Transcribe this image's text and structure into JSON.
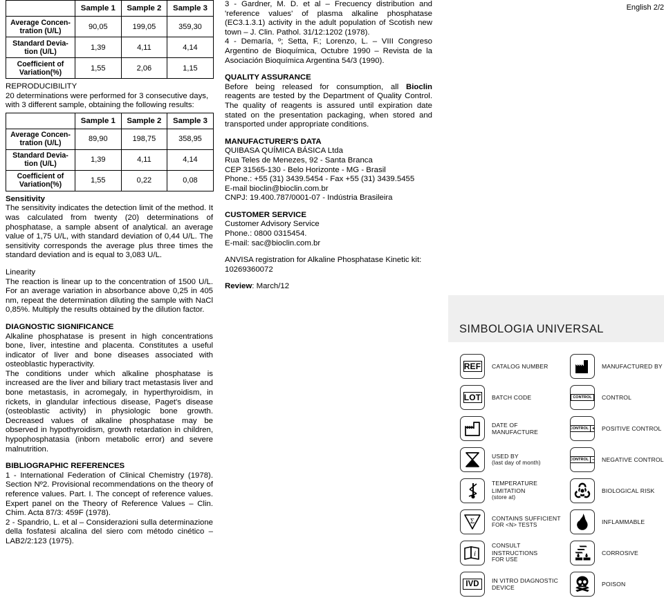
{
  "page": {
    "language_label": "English 2/2"
  },
  "left_column": {
    "table_precision": {
      "col_headers": [
        "",
        "Sample 1",
        "Sample 2",
        "Sample 3"
      ],
      "rows": [
        {
          "label": "Average Concen-\ntration (U/L)",
          "values": [
            "90,05",
            "199,05",
            "359,30"
          ]
        },
        {
          "label": "Standard Devia-\ntion (U/L)",
          "values": [
            "1,39",
            "4,11",
            "4,14"
          ]
        },
        {
          "label": "Coefficient of\nVariation(%)",
          "values": [
            "1,55",
            "2,06",
            "1,15"
          ]
        }
      ]
    },
    "reproducibility": {
      "heading": "REPRODUCIBILITY",
      "intro": "20 determinations were performed for 3 consecutive days, with 3 different sample, obtaining the following results:",
      "table": {
        "col_headers": [
          "",
          "Sample 1",
          "Sample 2",
          "Sample 3"
        ],
        "rows": [
          {
            "label": "Average Concen-\ntration (U/L)",
            "values": [
              "89,90",
              "198,75",
              "358,95"
            ]
          },
          {
            "label": "Standard Devia-\ntion (U/L)",
            "values": [
              "1,39",
              "4,11",
              "4,14"
            ]
          },
          {
            "label": "Coefficient of\nVariation(%)",
            "values": [
              "1,55",
              "0,22",
              "0,08"
            ]
          }
        ]
      }
    },
    "sensitivity": {
      "heading": "Sensitivity",
      "body": "The sensitivity indicates the detection limit of the method. It was calculated from twenty (20) determinations of phosphatase, a sample absent of analytical. an average value of 1,75 U/L, with standard deviation of 0,44 U/L. The sensitivity corresponds the average plus three times the standard deviation and is equal to 3,083 U/L."
    },
    "linearity": {
      "heading": "Linearity",
      "body": "The reaction is linear up to the concentration of 1500 U/L. For an average variation in absorbance above 0,25 in 405 nm, repeat the determination diluting the sample with NaCl 0,85%. Multiply the results obtained by the dilution factor."
    },
    "diagnostic_significance": {
      "heading": "DIAGNOSTIC SIGNIFICANCE",
      "paragraph_1": "Alkaline phosphatase is present in high concentrations bone, liver, intestine and placenta. Constitutes a useful indicator of liver and bone diseases associated with osteoblastic hyperactivity.",
      "paragraph_2": "The conditions under which alkaline phosphatase is increased are the liver and biliary tract metastasis liver and bone metastasis, in acromegaly, in hyperthyroidism, in rickets, in glandular infectious disease, Paget's disease (osteoblastic activity) in physiologic bone growth. Decreased values of alkaline phosphatase may be observed in hypothyroidism, growth retardation in children, hypophosphatasia (inborn metabolic error) and severe malnutrition."
    },
    "bibliographic_references": {
      "heading": "BIBLIOGRAPHIC REFERENCES",
      "ref_1": "1 - International Federation of Clinical Chemistry (1978). Section Nº2. Provisional recommendations on the theory of reference values. Part. I. The concept of reference values. Expert panel on the Theory of Reference Values – Clin. Chim. Acta 87/3: 459F (1978).",
      "ref_2": "2 - Spandrio, L. et al – Considerazioni sulla determinazione della fosfatesi alcalina del siero com método cinético – LAB2/2:123 (1975)."
    }
  },
  "middle_column": {
    "references_continued": {
      "ref_3": "3 - Gardner, M. D. et al – Frecuency distribution and 'reference values' of plasma alkaline phosphatase (EC3.1.3.1) activity in the adult population of Scotish new town – J. Clin. Pathol. 31/12:1202 (1978).",
      "ref_4": "4 - Demaría, º; Setta, F.; Lorenzo, L. – VIII Congreso Argentino de Bioquímica, Octubre 1990 – Revista de la Asociación Bioquímica Argentina 54/3 (1990)."
    },
    "quality_assurance": {
      "heading": "QUALITY ASSURANCE",
      "body_before_brand": "Before being released for consumption, all ",
      "brand": "Bioclin",
      "body_after_brand": " reagents are tested by the Department of Quality Control. The quality of reagents is assured until expiration date stated on the presentation packaging, when stored and transported under appropriate conditions."
    },
    "manufacturer_data": {
      "heading": "MANUFACTURER'S DATA",
      "lines": [
        "QUIBASA QUÍMICA BÁSICA Ltda",
        "Rua Teles de Menezes, 92 - Santa Branca",
        "CEP 31565-130 - Belo Horizonte - MG - Brasil",
        "Phone.: +55 (31) 3439.5454 - Fax +55 (31) 3439.5455",
        "E-mail bioclin@bioclin.com.br",
        "CNPJ: 19.400.787/0001-07 - Indústria Brasileira"
      ]
    },
    "customer_service": {
      "heading": "CUSTOMER SERVICE",
      "lines": [
        "Customer Advisory Service",
        "Phone.: 0800 0315454.",
        "E-mail: sac@bioclin.com.br"
      ]
    },
    "anvisa": {
      "line_1": "ANVISA registration for Alkaline Phosphatase Kinetic kit:",
      "line_2": "10269360072"
    },
    "review": {
      "label": "Review",
      "value": ": March/12"
    }
  },
  "right_column": {
    "symbols_band_title": "SIMBOLOGIA UNIVERSAL",
    "symbols_left": [
      {
        "icon": "ref-icon",
        "glyph": "REF",
        "label": "CATALOG NUMBER",
        "sublabel": ""
      },
      {
        "icon": "lot-icon",
        "glyph": "LOT",
        "label": "BATCH CODE",
        "sublabel": ""
      },
      {
        "icon": "factory-date-icon",
        "glyph": "",
        "label": "DATE OF MANUFACTURE",
        "sublabel": ""
      },
      {
        "icon": "hourglass-icon",
        "glyph": "",
        "label": "USED BY",
        "sublabel": "(last day of month)"
      },
      {
        "icon": "thermometer-icon",
        "glyph": "",
        "label": "TEMPERATURE LIMITATION",
        "sublabel": "(store at)"
      },
      {
        "icon": "sigma-triangle-icon",
        "glyph": "",
        "label": "CONTAINS SUFFICIENT",
        "sublabel": "FOR <N> TESTS"
      },
      {
        "icon": "instructions-book-icon",
        "glyph": "",
        "label": "CONSULT INSTRUCTIONS",
        "sublabel": "FOR USE"
      },
      {
        "icon": "ivd-icon",
        "glyph": "IVD",
        "label": "IN VITRO DIAGNOSTIC DEVICE",
        "sublabel": ""
      }
    ],
    "symbols_right": [
      {
        "icon": "factory-icon",
        "glyph": "",
        "sign": "",
        "label": "MANUFACTURED BY",
        "sublabel": ""
      },
      {
        "icon": "control-icon",
        "glyph": "CONTROL",
        "sign": "",
        "label": "CONTROL",
        "sublabel": ""
      },
      {
        "icon": "control-positive-icon",
        "glyph": "CONTROL",
        "sign": "+",
        "label": "POSITIVE CONTROL",
        "sublabel": ""
      },
      {
        "icon": "control-negative-icon",
        "glyph": "CONTROL",
        "sign": "–",
        "label": "NEGATIVE CONTROL",
        "sublabel": ""
      },
      {
        "icon": "biohazard-icon",
        "glyph": "",
        "sign": "",
        "label": "BIOLOGICAL RISK",
        "sublabel": ""
      },
      {
        "icon": "flame-icon",
        "glyph": "",
        "sign": "",
        "label": "INFLAMMABLE",
        "sublabel": ""
      },
      {
        "icon": "corrosive-icon",
        "glyph": "",
        "sign": "",
        "label": "CORROSIVE",
        "sublabel": ""
      },
      {
        "icon": "skull-icon",
        "glyph": "",
        "sign": "",
        "label": "POISON",
        "sublabel": ""
      }
    ]
  }
}
